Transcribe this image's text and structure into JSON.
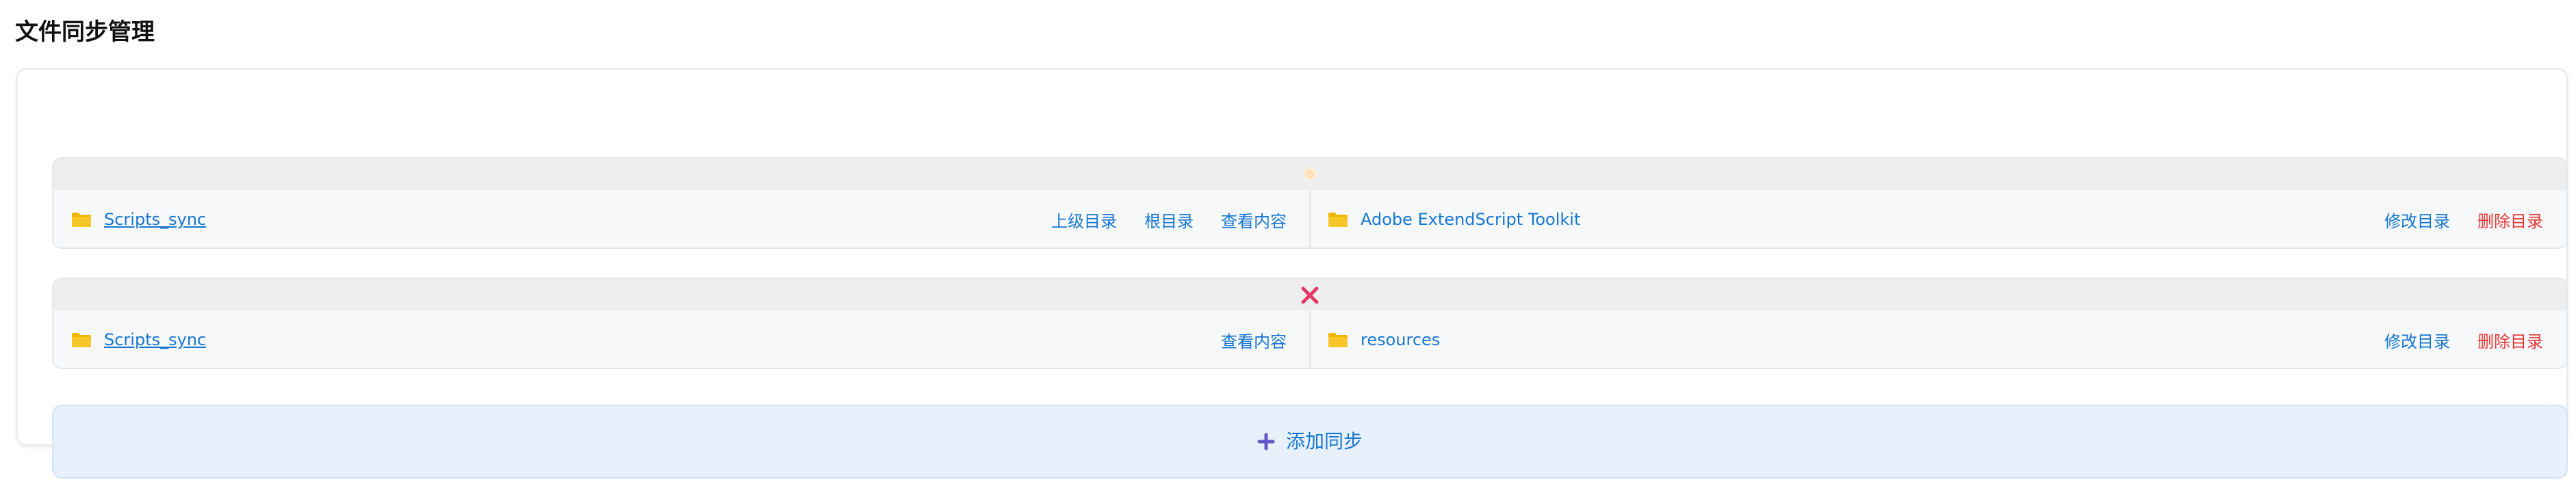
{
  "page_title": "文件同步管理",
  "colors": {
    "link": "#1677d2",
    "danger": "#e53935",
    "folder": "#f2b600",
    "error": "#e53965",
    "add_plus": "#6256c9"
  },
  "syncs": [
    {
      "status": "ok",
      "status_icon": "clock-icon",
      "left": {
        "name": "Scripts_sync",
        "icon": "folder-icon",
        "actions": [
          "上级目录",
          "根目录",
          "查看内容"
        ]
      },
      "right": {
        "name": "Adobe ExtendScript Toolkit",
        "icon": "folder-icon",
        "actions": [
          "修改目录",
          "删除目录"
        ]
      }
    },
    {
      "status": "error",
      "status_icon": "x-mark-icon",
      "left": {
        "name": "Scripts_sync",
        "icon": "folder-icon",
        "actions": [
          "查看内容"
        ]
      },
      "right": {
        "name": "resources",
        "icon": "folder-icon",
        "actions": [
          "修改目录",
          "删除目录"
        ]
      }
    }
  ],
  "add_sync": {
    "label": "添加同步",
    "icon": "plus-icon"
  }
}
